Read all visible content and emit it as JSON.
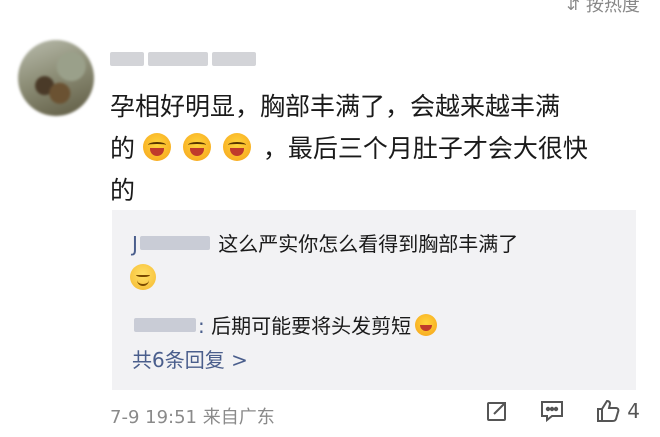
{
  "sort": {
    "label": "按热度"
  },
  "comment": {
    "text_line1": "孕相好明显，胸部丰满了，会越来越丰满",
    "text_line2_prefix": "的",
    "emoji_name": "laughing-face-icon",
    "text_line2_suffix": "，最后三个月肚子才会大很快",
    "text_line3": "的"
  },
  "replies": [
    {
      "name_initial": "J",
      "separator": "",
      "text": "这么严实你怎么看得到胸部丰满了",
      "emoji": "smile-face-icon"
    },
    {
      "name_initial": "",
      "separator": ":",
      "text": "后期可能要将头发剪短",
      "emoji": "laughing-face-icon"
    }
  ],
  "view_all": "共6条回复 >",
  "meta": {
    "date_time": "7-9 19:51",
    "location": "来自广东"
  },
  "actions": {
    "share_icon": "share-icon",
    "comment_icon": "comment-icon",
    "like_icon": "like-icon",
    "like_count": "4"
  },
  "colors": {
    "link": "#4a5e8c",
    "reply_bg": "#f2f2f4",
    "meta": "#8a8a8a"
  }
}
